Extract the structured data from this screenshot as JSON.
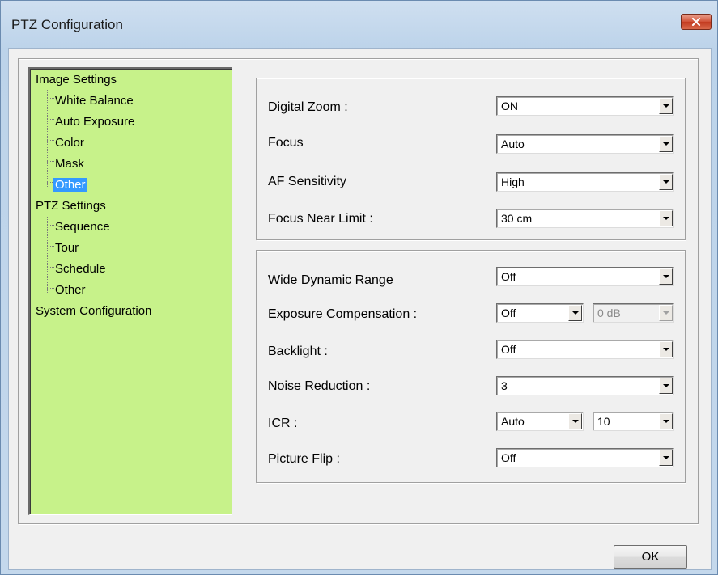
{
  "window": {
    "title": "PTZ Configuration"
  },
  "tree": {
    "groups": [
      {
        "label": "Image Settings",
        "children": [
          "White Balance",
          "Auto Exposure",
          "Color",
          "Mask",
          "Other"
        ]
      },
      {
        "label": "PTZ Settings",
        "children": [
          "Sequence",
          "Tour",
          "Schedule",
          "Other"
        ]
      },
      {
        "label": "System Configuration",
        "children": []
      }
    ],
    "selected": "Image Settings / Other"
  },
  "focus_panel": {
    "digital_zoom": {
      "label": "Digital Zoom :",
      "value": "ON"
    },
    "focus": {
      "label": "Focus",
      "value": "Auto"
    },
    "af_sensitivity": {
      "label": "AF Sensitivity",
      "value": "High"
    },
    "focus_near_limit": {
      "label": "Focus Near Limit :",
      "value": "30 cm"
    }
  },
  "exposure_panel": {
    "wdr": {
      "label": "Wide Dynamic Range",
      "value": "Off"
    },
    "exposure_compensation": {
      "label": "Exposure Compensation :",
      "value": "Off",
      "level": "0 dB"
    },
    "backlight": {
      "label": "Backlight :",
      "value": "Off"
    },
    "noise_reduction": {
      "label": "Noise Reduction :",
      "value": "3"
    },
    "icr": {
      "label": "ICR :",
      "value": "Auto",
      "level": "10"
    },
    "picture_flip": {
      "label": "Picture Flip :",
      "value": "Off"
    }
  },
  "buttons": {
    "ok": "OK"
  },
  "colors": {
    "tree_background": "#c7f28a",
    "selection": "#3399ff",
    "close_button": "#c23a1f"
  }
}
